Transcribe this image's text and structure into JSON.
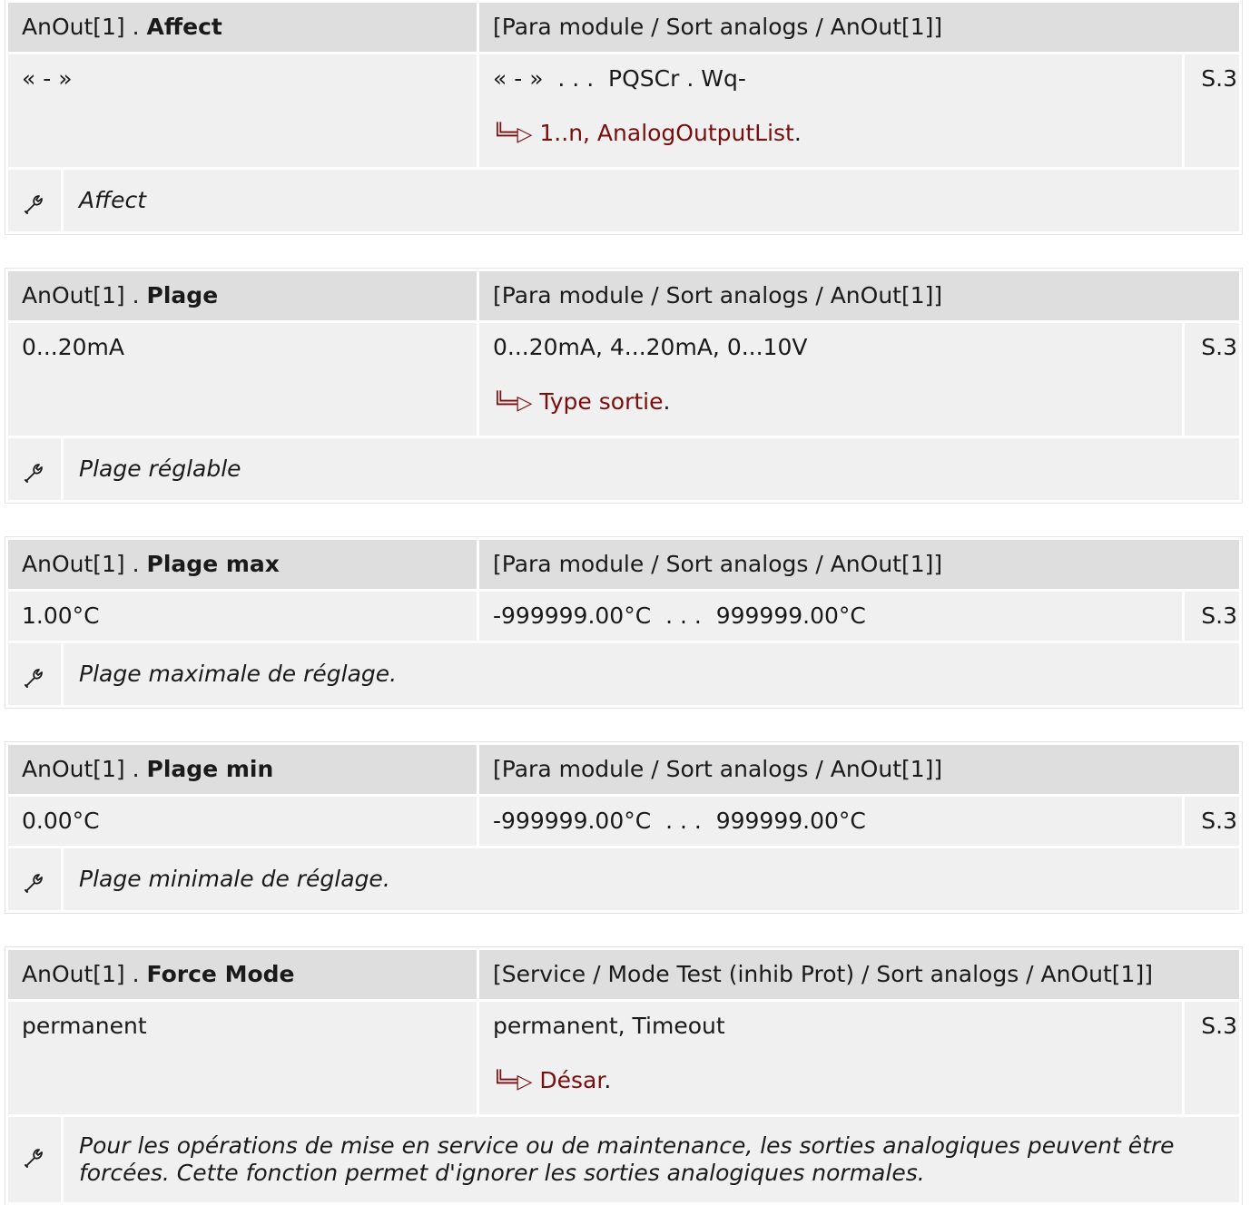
{
  "params": [
    {
      "prefix": "AnOut[1] . ",
      "name": "Affect",
      "path": "[Para module / Sort analogs / AnOut[1]]",
      "default": "« - »",
      "range": "« - »  . . .  PQSCr . Wq-",
      "ref": "S.3",
      "link": "1..n, AnalogOutputList",
      "description": "Affect"
    },
    {
      "prefix": "AnOut[1] . ",
      "name": "Plage",
      "path": "[Para module / Sort analogs / AnOut[1]]",
      "default": "0...20mA",
      "range": "0...20mA, 4...20mA, 0...10V",
      "ref": "S.3",
      "link": "Type sortie",
      "description": "Plage réglable"
    },
    {
      "prefix": "AnOut[1] . ",
      "name": "Plage max",
      "path": "[Para module / Sort analogs / AnOut[1]]",
      "default": "1.00°C",
      "range": "-999999.00°C  . . .  999999.00°C",
      "ref": "S.3",
      "description": "Plage maximale de réglage."
    },
    {
      "prefix": "AnOut[1] . ",
      "name": "Plage min",
      "path": "[Para module / Sort analogs / AnOut[1]]",
      "default": "0.00°C",
      "range": "-999999.00°C  . . .  999999.00°C",
      "ref": "S.3",
      "description": "Plage minimale de réglage."
    },
    {
      "prefix": "AnOut[1] . ",
      "name": "Force Mode",
      "path": "[Service / Mode Test (inhib Prot) / Sort analogs / AnOut[1]]",
      "default": "permanent",
      "range": "permanent, Timeout",
      "ref": "S.3",
      "link": "Désar",
      "description": "Pour les opérations de mise en service ou de maintenance, les sorties analogiques peuvent être forcées. Cette fonction permet d'ignorer les sorties analogiques normales."
    }
  ],
  "link_arrow": "╚═▷",
  "icon": "wrench-icon"
}
